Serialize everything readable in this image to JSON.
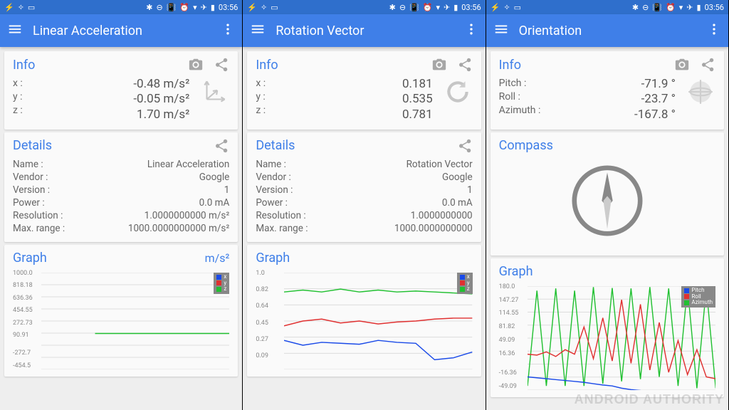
{
  "status": {
    "time": "03:56"
  },
  "screens": [
    {
      "title": "Linear Acceleration",
      "info": {
        "title": "Info",
        "icon": "axes",
        "rows": [
          {
            "label": "x :",
            "value": "-0.48 m/s²"
          },
          {
            "label": "y :",
            "value": "-0.05 m/s²"
          },
          {
            "label": "z :",
            "value": "1.70 m/s²"
          }
        ]
      },
      "details": {
        "title": "Details",
        "rows": [
          {
            "label": "Name :",
            "value": "Linear Acceleration"
          },
          {
            "label": "Vendor :",
            "value": "Google"
          },
          {
            "label": "Version :",
            "value": "1"
          },
          {
            "label": "Power :",
            "value": "0.0 mA"
          },
          {
            "label": "Resolution :",
            "value": "1.0000000000 m/s²"
          },
          {
            "label": "Max. range :",
            "value": "1000.0000000000 m/s²"
          }
        ]
      },
      "graph": {
        "title": "Graph",
        "unit": "m/s²",
        "yticks": [
          "1000.0",
          "818.18",
          "636.36",
          "454.55",
          "272.73",
          "90.91",
          "",
          "-272.7",
          "-454.5"
        ],
        "legend": [
          "x",
          "y",
          "z"
        ]
      }
    },
    {
      "title": "Rotation Vector",
      "info": {
        "title": "Info",
        "icon": "refresh",
        "rows": [
          {
            "label": "x :",
            "value": "0.181"
          },
          {
            "label": "y :",
            "value": "0.535"
          },
          {
            "label": "z :",
            "value": "0.781"
          }
        ]
      },
      "details": {
        "title": "Details",
        "rows": [
          {
            "label": "Name :",
            "value": "Rotation Vector"
          },
          {
            "label": "Vendor :",
            "value": "Google"
          },
          {
            "label": "Version :",
            "value": "1"
          },
          {
            "label": "Power :",
            "value": "0.0 mA"
          },
          {
            "label": "Resolution :",
            "value": "1.0000000000"
          },
          {
            "label": "Max. range :",
            "value": "1000.0000000000"
          }
        ]
      },
      "graph": {
        "title": "Graph",
        "unit": "",
        "yticks": [
          "1.0",
          "0.82",
          "0.64",
          "0.45",
          "0.27",
          "0.09",
          ""
        ],
        "legend": [
          "x",
          "y",
          "z"
        ]
      }
    },
    {
      "title": "Orientation",
      "info": {
        "title": "Info",
        "icon": "sphere",
        "rows": [
          {
            "label": "Pitch :",
            "value": "-71.9 °"
          },
          {
            "label": "Roll :",
            "value": "-23.7 °"
          },
          {
            "label": "Azimuth :",
            "value": "-167.8 °"
          }
        ]
      },
      "compass": {
        "title": "Compass"
      },
      "graph": {
        "title": "Graph",
        "unit": "",
        "yticks": [
          "180.0",
          "147.27",
          "114.55",
          "81.82",
          "49.09",
          "16.36",
          "",
          "-16.36",
          "-49.09"
        ],
        "legend": [
          "Pitch",
          "Roll",
          "Azimuth"
        ]
      }
    }
  ],
  "legend_colors": {
    "0": "#1a4ae8",
    "1": "#e03030",
    "2": "#20c030"
  },
  "watermark": "ANDROID AUTHORITY",
  "chart_data": [
    {
      "type": "line",
      "title": "Linear Acceleration",
      "ylabel": "m/s²",
      "ylim": [
        -454.5,
        1000.0
      ],
      "yticks": [
        1000.0,
        818.18,
        636.36,
        454.55,
        272.73,
        90.91,
        -272.7,
        -454.5
      ],
      "series": [
        {
          "name": "x",
          "color": "#1a4ae8",
          "values": [
            0,
            0,
            0,
            0,
            0
          ]
        },
        {
          "name": "y",
          "color": "#e03030",
          "values": [
            0,
            0,
            0,
            0,
            0
          ]
        },
        {
          "name": "z",
          "color": "#20c030",
          "values": [
            2,
            2,
            2,
            2,
            2
          ]
        }
      ],
      "note": "Traces hover near zero·m/s² over the full window; only green(z) is visible as a flat horizontal line around ~1–2 m/s² on a ±1000 scale."
    },
    {
      "type": "line",
      "title": "Rotation Vector",
      "ylabel": "",
      "ylim": [
        0.0,
        1.0
      ],
      "yticks": [
        1.0,
        0.82,
        0.64,
        0.45,
        0.27,
        0.09
      ],
      "x": [
        0,
        0.1,
        0.2,
        0.3,
        0.4,
        0.5,
        0.6,
        0.7,
        0.8,
        0.9,
        1.0
      ],
      "series": [
        {
          "name": "x",
          "color": "#1a4ae8",
          "values": [
            0.3,
            0.25,
            0.28,
            0.27,
            0.26,
            0.3,
            0.28,
            0.27,
            0.1,
            0.12,
            0.18
          ]
        },
        {
          "name": "y",
          "color": "#e03030",
          "values": [
            0.45,
            0.5,
            0.52,
            0.48,
            0.5,
            0.47,
            0.49,
            0.5,
            0.52,
            0.53,
            0.53
          ]
        },
        {
          "name": "z",
          "color": "#20c030",
          "values": [
            0.8,
            0.82,
            0.8,
            0.83,
            0.8,
            0.82,
            0.8,
            0.81,
            0.8,
            0.79,
            0.78
          ]
        }
      ]
    },
    {
      "type": "line",
      "title": "Orientation",
      "ylabel": "°",
      "ylim": [
        -49.09,
        180.0
      ],
      "yticks": [
        180.0,
        147.27,
        114.55,
        81.82,
        49.09,
        16.36,
        -16.36,
        -49.09
      ],
      "x": [
        0,
        0.05,
        0.1,
        0.15,
        0.2,
        0.25,
        0.3,
        0.35,
        0.4,
        0.45,
        0.5,
        0.55,
        0.6,
        0.65,
        0.7,
        0.75,
        0.8,
        0.85,
        0.9,
        0.95,
        1.0
      ],
      "series": [
        {
          "name": "Pitch",
          "color": "#1a4ae8",
          "values": [
            -20,
            -22,
            -24,
            -26,
            -28,
            -30,
            -32,
            -35,
            -38,
            -40,
            -45,
            -48,
            -50,
            -55,
            -58,
            -62,
            -65,
            -68,
            -70,
            -71,
            -72
          ]
        },
        {
          "name": "Roll",
          "color": "#e03030",
          "values": [
            30,
            28,
            35,
            25,
            40,
            30,
            90,
            20,
            110,
            15,
            150,
            10,
            140,
            -5,
            100,
            -10,
            60,
            -15,
            40,
            -20,
            -24
          ]
        },
        {
          "name": "Azimuth",
          "color": "#20c030",
          "values": [
            -40,
            170,
            -40,
            175,
            -40,
            170,
            -40,
            178,
            -35,
            176,
            -30,
            175,
            -25,
            178,
            -20,
            175,
            -40,
            178,
            -45,
            176,
            -45
          ]
        }
      ],
      "note": "Green (Azimuth) shows many rapid wrap-around spikes between roughly -45° and ~180°; red (Roll) shows large irregular swings; blue (Pitch) trends steadily downward."
    }
  ]
}
